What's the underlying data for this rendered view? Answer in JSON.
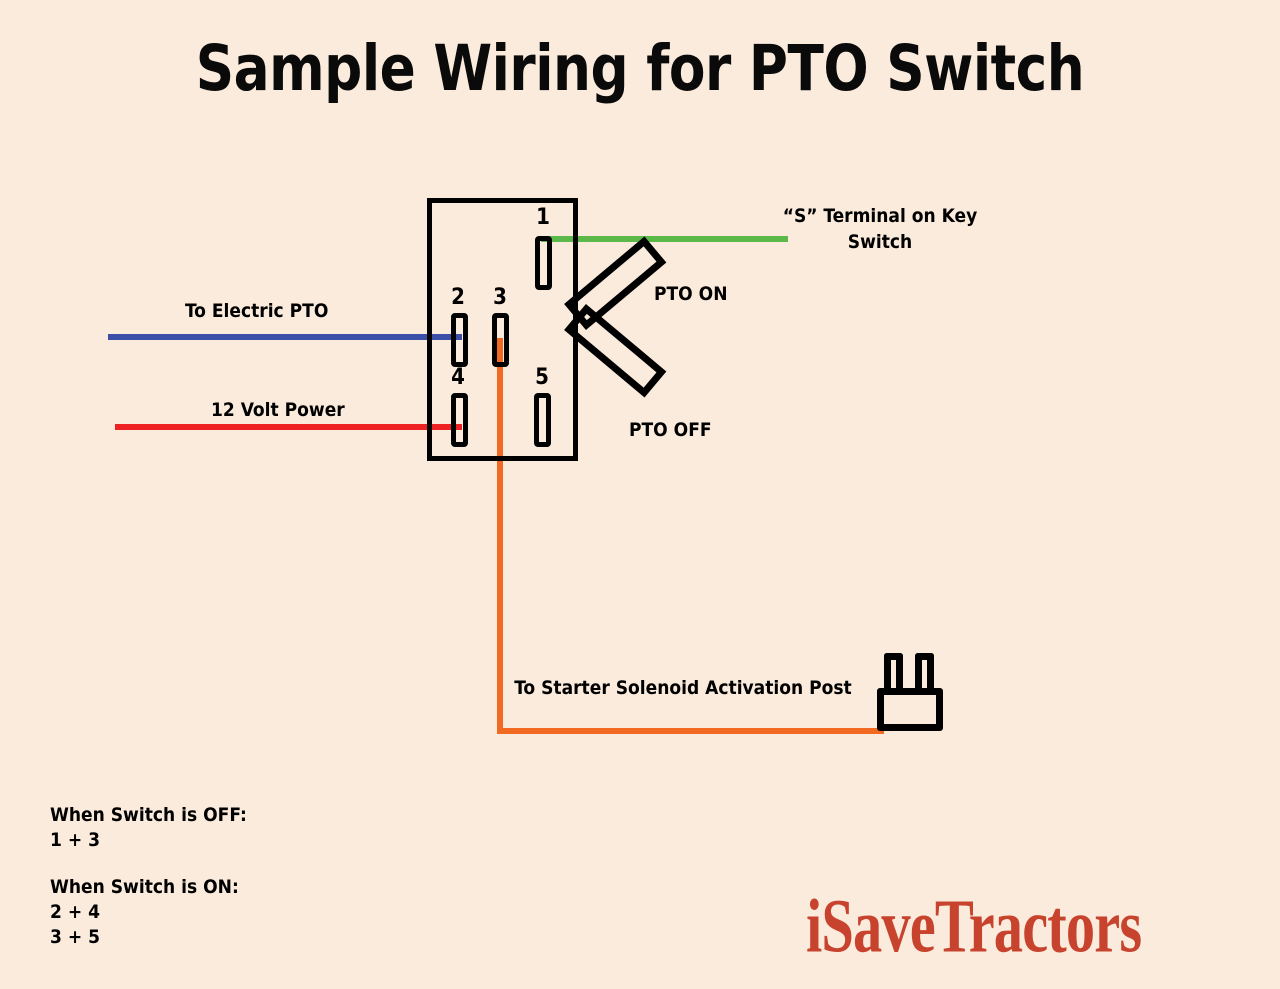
{
  "title": "Sample Wiring for PTO Switch",
  "background_color": "#faebdc",
  "switch": {
    "terminals": [
      {
        "id": "1",
        "label": "1"
      },
      {
        "id": "2",
        "label": "2"
      },
      {
        "id": "3",
        "label": "3"
      },
      {
        "id": "4",
        "label": "4"
      },
      {
        "id": "5",
        "label": "5"
      }
    ],
    "lever_on_label": "PTO ON",
    "lever_off_label": "PTO OFF"
  },
  "wires": [
    {
      "name": "key-switch-wire",
      "color": "#5cb848",
      "label": "“S” Terminal on Key Switch",
      "from_terminal": "1"
    },
    {
      "name": "electric-pto-wire",
      "color": "#3c4fa8",
      "label": "To Electric PTO",
      "from_terminal": "2"
    },
    {
      "name": "power-wire",
      "color": "#ee2222",
      "label": "12 Volt Power",
      "from_terminal": "4"
    },
    {
      "name": "solenoid-wire",
      "color": "#f26a21",
      "label": "To Starter Solenoid Activation Post",
      "from_terminal": "3"
    }
  ],
  "labels": {
    "key_switch": "“S” Terminal on Key Switch",
    "electric_pto": "To Electric PTO",
    "twelve_volt": "12 Volt Power",
    "solenoid": "To Starter Solenoid Activation Post",
    "pto_on": "PTO ON",
    "pto_off": "PTO OFF"
  },
  "legend": {
    "off_heading": "When Switch is OFF:",
    "off_rows": [
      "1 + 3"
    ],
    "on_heading": "When Switch is ON:",
    "on_rows": [
      "2 + 4",
      "3 + 5"
    ]
  },
  "logo": {
    "text": "iSaveTractors",
    "color": "#c8432e"
  }
}
